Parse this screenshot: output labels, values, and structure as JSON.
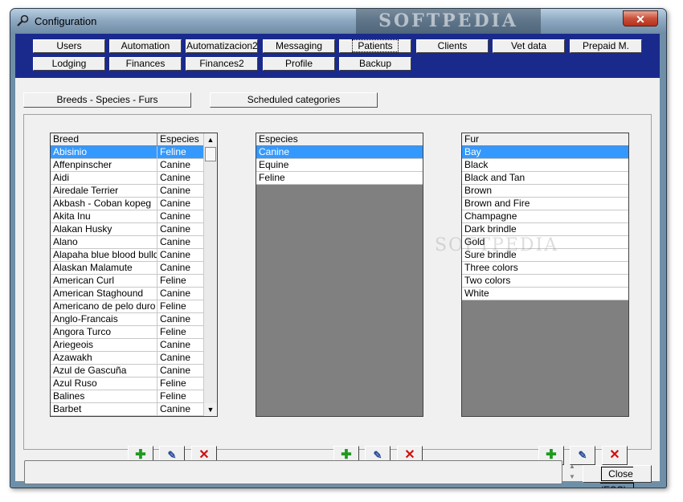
{
  "window": {
    "title": "Configuration",
    "close_glyph": "✕",
    "titlebar_watermark": "SOFTPEDIA"
  },
  "tabs": [
    {
      "label": "Users"
    },
    {
      "label": "Automation"
    },
    {
      "label": "Automatizacion2"
    },
    {
      "label": "Messaging"
    },
    {
      "label": "Patients",
      "active": true
    },
    {
      "label": "Clients"
    },
    {
      "label": "Vet data"
    },
    {
      "label": "Prepaid M."
    },
    {
      "label": "Lodging"
    },
    {
      "label": "Finances"
    },
    {
      "label": "Finances2"
    },
    {
      "label": "Profile"
    },
    {
      "label": "Backup"
    }
  ],
  "subtabs": [
    {
      "label": "Breeds - Species - Furs"
    },
    {
      "label": "Scheduled categories"
    }
  ],
  "breeds": {
    "headers": [
      "Breed",
      "Especies"
    ],
    "rows": [
      [
        "Abisinio",
        "Feline"
      ],
      [
        "Affenpinscher",
        "Canine"
      ],
      [
        "Aidi",
        "Canine"
      ],
      [
        "Airedale Terrier",
        "Canine"
      ],
      [
        "Akbash - Coban kopeg",
        "Canine"
      ],
      [
        "Akita Inu",
        "Canine"
      ],
      [
        "Alakan Husky",
        "Canine"
      ],
      [
        "Alano",
        "Canine"
      ],
      [
        "Alapaha blue blood bulldog",
        "Canine"
      ],
      [
        "Alaskan Malamute",
        "Canine"
      ],
      [
        "American Curl",
        "Feline"
      ],
      [
        "American Staghound",
        "Canine"
      ],
      [
        "Americano de pelo duro",
        "Feline"
      ],
      [
        "Anglo-Francais",
        "Canine"
      ],
      [
        "Angora Turco",
        "Feline"
      ],
      [
        "Ariegeois",
        "Canine"
      ],
      [
        "Azawakh",
        "Canine"
      ],
      [
        "Azul de Gascuña",
        "Canine"
      ],
      [
        "Azul Ruso",
        "Feline"
      ],
      [
        "Balines",
        "Feline"
      ],
      [
        "Barbet",
        "Canine"
      ]
    ],
    "selected_index": 0
  },
  "species": {
    "header": "Especies",
    "rows": [
      "Canine",
      "Equine",
      "Feline"
    ],
    "selected_index": 0
  },
  "furs": {
    "header": "Fur",
    "rows": [
      "Bay",
      "Black",
      "Black and Tan",
      "Brown",
      "Brown and Fire",
      "Champagne",
      "Dark brindle",
      "Gold",
      "Sure brindle",
      "Three colors",
      "Two colors",
      "White"
    ],
    "selected_index": 0
  },
  "actions": {
    "add_icon": "plus-icon",
    "edit_icon": "edit-icon",
    "delete_icon": "delete-icon",
    "add_glyph": "✚",
    "edit_glyph": "✎",
    "delete_glyph": "✕"
  },
  "status": {
    "text": ""
  },
  "footer": {
    "close_label": "Close (ESC)",
    "spin_up": "▲",
    "spin_down": "▼"
  },
  "scroll": {
    "up": "▲",
    "down": "▼"
  },
  "watermark": "SOFTPEDIA",
  "colors": {
    "tabbar": "#1a2a8c",
    "selection": "#3399ff",
    "add": "#1f9a1f",
    "delete": "#d01010"
  }
}
